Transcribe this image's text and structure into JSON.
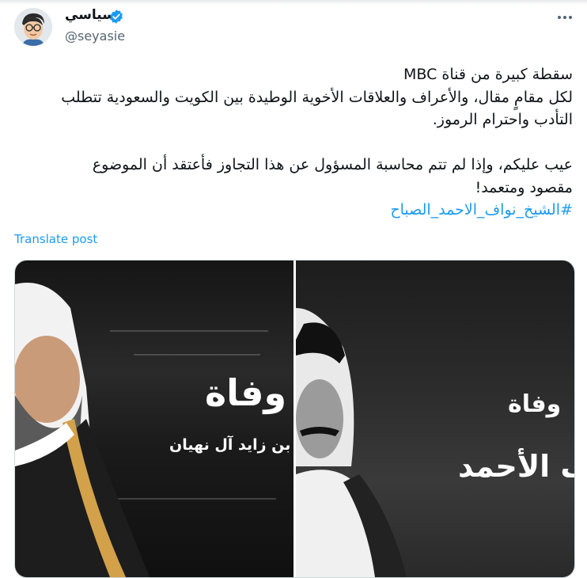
{
  "header": {
    "display_name": "سياسي",
    "handle": "@seyasie"
  },
  "tweet": {
    "lines_para1": [
      "سقطة كبيرة من قناة MBC",
      "لكل مقامٍ مقال، والأعراف والعلاقات الأخوية الوطيدة بين الكويت والسعودية تتطلب",
      "التأدب واحترام الرموز."
    ],
    "lines_para2": [
      "عيب عليكم، وإذا لم تتم محاسبة المسؤول عن هذا التجاوز فأعتقد أن الموضوع",
      "مقصود ومتعمد!"
    ],
    "hashtag": "#الشيخ_نواف_الاحمد_الصباح",
    "translate_label": "Translate post"
  },
  "media": {
    "left": {
      "title": "وفاة",
      "subtitle": "يفة بن زايد آل نهيان"
    },
    "right": {
      "title": "وفاة",
      "subtitle": "ف الأحمد"
    }
  },
  "colors": {
    "link": "#1d9bf0",
    "muted": "#536471",
    "text": "#0f1419"
  },
  "icons": [
    "verified-badge-icon",
    "more-options-icon"
  ]
}
